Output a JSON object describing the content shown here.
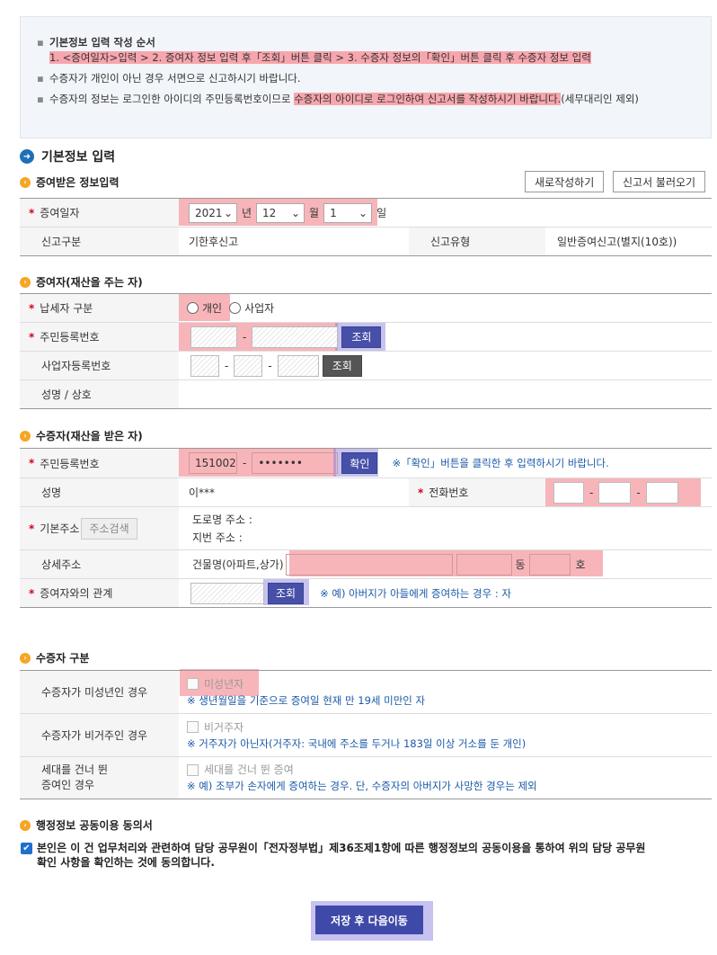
{
  "guide": {
    "line1_title": "기본정보 입력 작성 순서",
    "line1_body": "1. <증여일자>입력 > 2. 증여자 정보 입력 후「조회」버튼 클릭 > 3. 수증자 정보의「확인」버튼 클릭 후 수증자 정보 입력",
    "line2": "수증자가 개인이 아닌 경우 서면으로 신고하시기 바랍니다.",
    "line3_a": "수증자의 정보는 로그인한 아이디의 주민등록번호이므로 ",
    "line3_hl": "수증자의 아이디로 로그인하여 신고서를 작성하시기 바랍니다.",
    "line3_b": "(세무대리인 제외)"
  },
  "section_title": "기본정보 입력",
  "received": {
    "title": "증여받은 정보입력",
    "new_button": "새로작성하기",
    "load_button": "신고서 불러오기",
    "date_label": "증여일자",
    "year": "2021",
    "year_unit": "년",
    "month": "12",
    "month_unit": "월",
    "day": "1",
    "day_unit": "일",
    "report_type_label": "신고구분",
    "report_type_value": "기한후신고",
    "report_kind_label": "신고유형",
    "report_kind_value": "일반증여신고(별지(10호))"
  },
  "donor": {
    "title": "증여자(재산을 주는 자)",
    "taxpayer_label": "납세자 구분",
    "opt_individual": "개인",
    "opt_business": "사업자",
    "rrn_label": "주민등록번호",
    "lookup": "조회",
    "brn_label": "사업자등록번호",
    "name_label": "성명 / 상호"
  },
  "recipient": {
    "title": "수증자(재산을 받은 자)",
    "rrn_label": "주민등록번호",
    "rrn_front": "151002",
    "rrn_back": "•••••••",
    "confirm": "확인",
    "rrn_note": "※「확인」버튼을 클릭한 후 입력하시기 바랍니다.",
    "name_label": "성명",
    "name_value": "이***",
    "phone_label": "전화번호",
    "address_label": "기본주소",
    "address_search": "주소검색",
    "road_address": "도로명 주소 :",
    "lot_address": "지번 주소 :",
    "detail_label": "상세주소",
    "building_label": "건물명(아파트,상가)",
    "dong": "동",
    "ho": "호",
    "relation_label": "증여자와의 관계",
    "relation_lookup": "조회",
    "relation_note": "※ 예) 아버지가 아들에게 증여하는 경우 : 자"
  },
  "recipient_type": {
    "title": "수증자 구분",
    "minor_label": "수증자가 미성년인 경우",
    "minor_check": "미성년자",
    "minor_note": "※ 생년월일을 기준으로 증여일 현재 만 19세 미만인 자",
    "nonres_label": "수증자가 비거주인 경우",
    "nonres_check": "비거주자",
    "nonres_note": "※ 거주자가 아닌자(거주자: 국내에 주소를 두거나 183일 이상 거소를 둔 개인)",
    "gen_label_1": "세대를 건너 뛴",
    "gen_label_2": "증여인 경우",
    "gen_check": "세대를 건너 뛴 증여",
    "gen_note": "※ 예) 조부가 손자에게 증여하는 경우. 단, 수증자의 아버지가 사망한 경우는 제외"
  },
  "consent": {
    "title": "행정정보 공동이용 동의서",
    "text": "본인은 이 건 업무처리와 관련하여 담당 공무원이「전자정부법」제36조제1항에 따른 행정정보의 공동이용을 통하여 위의 담당 공무원 확인 사항을 확인하는 것에 동의합니다."
  },
  "save_button": "저장 후 다음이동",
  "colors": {
    "accent_blue": "#4750a8",
    "highlight_red": "#f7a6ad",
    "required": "#d0021b",
    "note_blue": "#1a5aa8"
  }
}
